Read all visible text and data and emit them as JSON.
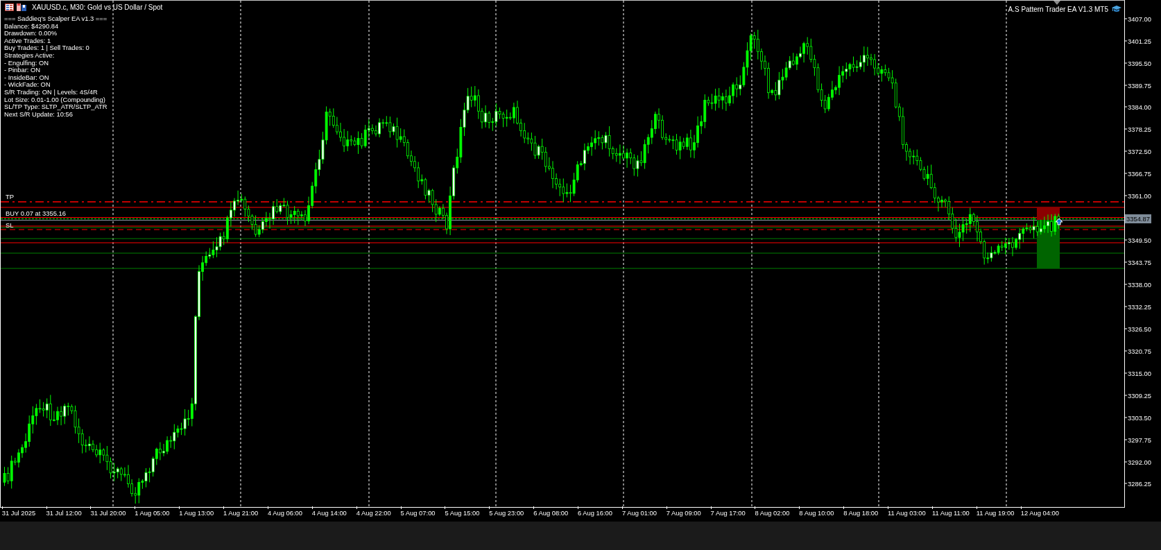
{
  "window": {
    "symbol_title": "XAUUSD.c, M30:  Gold vs US Dollar / Spot"
  },
  "ea_panel": {
    "lines": [
      "=== Saddieq's Scalper EA v1.3 ===",
      "Balance: $4290.84",
      "Drawdown: 0.00%",
      "Active Trades: 1",
      "Buy Trades: 1 | Sell Trades: 0",
      "Strategies Active:",
      "- Engulfing: ON",
      "- Pinbar: ON",
      "- InsideBar: ON",
      "- WickFade: ON",
      "S/R Trading: ON | Levels: 4S/4R",
      "Lot Size: 0.01-1.00 (Compounding)",
      "SL/TP Type: SLTP_ATR/SLTP_ATR",
      "Next S/R Update: 10:56"
    ]
  },
  "indicator_label": "A.S Pattern Trader EA V1.3 MT5",
  "levels": [
    {
      "label": "TP",
      "kind": "take-profit"
    },
    {
      "label": "BUY 0.07 at 3355.16",
      "kind": "entry"
    },
    {
      "label": "SL",
      "kind": "stop-loss"
    }
  ],
  "price_axis": {
    "ticks": [
      "3407.00",
      "3401.25",
      "3395.50",
      "3389.75",
      "3384.00",
      "3378.25",
      "3372.50",
      "3366.75",
      "3361.00",
      "3349.50",
      "3343.75",
      "3338.00",
      "3332.25",
      "3326.50",
      "3320.75",
      "3315.00",
      "3309.25",
      "3303.50",
      "3297.75",
      "3292.00",
      "3286.25"
    ],
    "current_price": "3354.87"
  },
  "time_axis": {
    "labels": [
      "31 Jul 2025",
      "31 Jul 12:00",
      "31 Jul 20:00",
      "1 Aug 05:00",
      "1 Aug 13:00",
      "1 Aug 21:00",
      "4 Aug 06:00",
      "4 Aug 14:00",
      "4 Aug 22:00",
      "5 Aug 07:00",
      "5 Aug 15:00",
      "5 Aug 23:00",
      "6 Aug 08:00",
      "6 Aug 16:00",
      "7 Aug 01:00",
      "7 Aug 09:00",
      "7 Aug 17:00",
      "8 Aug 02:00",
      "8 Aug 10:00",
      "8 Aug 18:00",
      "11 Aug 03:00",
      "11 Aug 11:00",
      "11 Aug 19:00",
      "12 Aug 04:00"
    ]
  }
}
